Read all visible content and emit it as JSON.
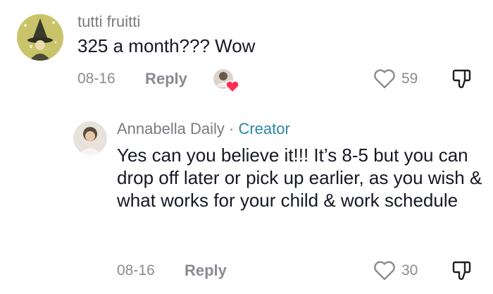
{
  "comments": [
    {
      "author": "tutti fruitti",
      "text": "325 a month??? Wow",
      "date": "08-16",
      "reply_label": "Reply",
      "likes": "59",
      "avatar_icon": "witch-avatar"
    }
  ],
  "reply": {
    "author": "Annabella Daily",
    "separator": "·",
    "badge": "Creator",
    "text": "Yes can you believe it!!! It’s 8-5 but you can drop off later or pick up earlier, as you wish & what works for your child & work schedule",
    "date": "08-16",
    "reply_label": "Reply",
    "likes": "30",
    "avatar_icon": "user-avatar"
  },
  "icons": {
    "heart": "heart-outline-icon",
    "dislike": "thumbs-down-icon",
    "creator_liked": "creator-liked-heart-icon"
  },
  "colors": {
    "text": "#161823",
    "muted": "#8a8b91",
    "creator": "#2b88a4",
    "like_badge": "#fe2c55"
  }
}
